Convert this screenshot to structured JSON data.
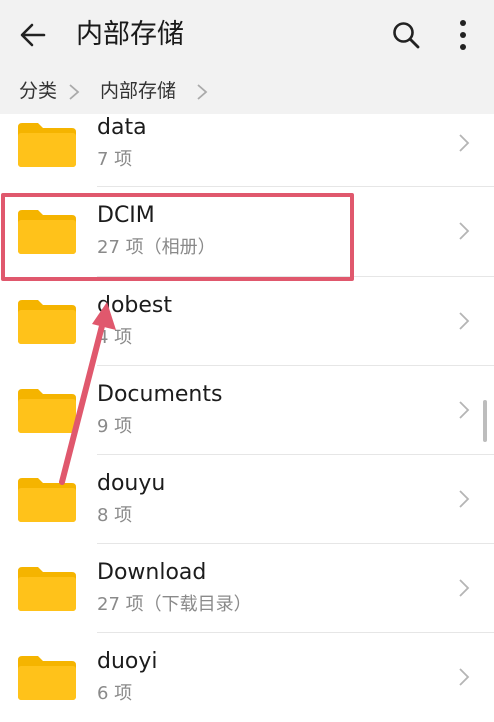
{
  "header": {
    "title": "内部存储",
    "back_icon": "arrow-left-icon",
    "search_icon": "search-icon",
    "more_icon": "more-vertical-icon"
  },
  "breadcrumb": {
    "items": [
      "分类",
      "内部存储"
    ]
  },
  "folders": [
    {
      "name": "data",
      "meta": "7 项"
    },
    {
      "name": "DCIM",
      "meta": "27 项（相册）"
    },
    {
      "name": "dobest",
      "meta": "4 项"
    },
    {
      "name": "Documents",
      "meta": "9 项"
    },
    {
      "name": "douyu",
      "meta": "8 项"
    },
    {
      "name": "Download",
      "meta": "27 项（下载目录）"
    },
    {
      "name": "duoyi",
      "meta": "6 项"
    }
  ],
  "colors": {
    "folder": "#ffc21a",
    "folder_tab": "#f5b400",
    "annotation": "#e0586d",
    "header_bg": "#f2f2f2"
  }
}
